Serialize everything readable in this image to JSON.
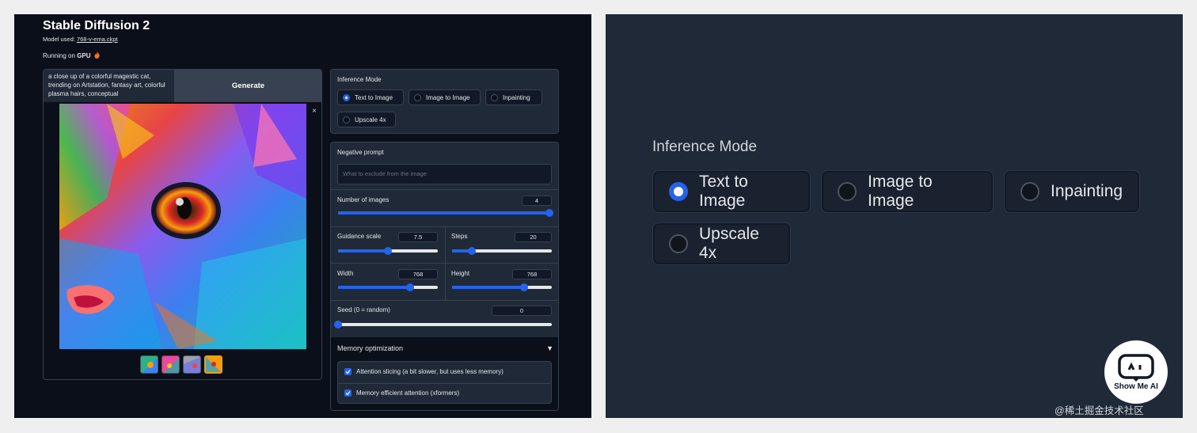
{
  "app": {
    "title": "Stable Diffusion 2",
    "model_label": "Model used:",
    "model_name": "768-v-ema.ckpt",
    "running_label": "Running on",
    "running_device": "GPU"
  },
  "prompt": {
    "value": "a close up of a colorful magestic cat, trending on Artstation, fantasy art, colorful plasma hairs, conceptual"
  },
  "generate_label": "Generate",
  "preview": {
    "close_glyph": "×"
  },
  "inference_mode": {
    "label": "Inference Mode",
    "options": [
      "Text to Image",
      "Image to Image",
      "Inpainting",
      "Upscale 4x"
    ],
    "selected": "Text to Image"
  },
  "negative_prompt": {
    "label": "Negative prompt",
    "placeholder": "What to exclude from the image"
  },
  "num_images": {
    "label": "Number of images",
    "value": "4",
    "fraction": 1.0
  },
  "guidance": {
    "label": "Guidance scale",
    "value": "7.5",
    "fraction": 0.5
  },
  "steps": {
    "label": "Steps",
    "value": "20",
    "fraction": 0.2
  },
  "width": {
    "label": "Width",
    "value": "768",
    "fraction": 0.72
  },
  "height": {
    "label": "Height",
    "value": "768",
    "fraction": 0.72
  },
  "seed": {
    "label": "Seed (0 = random)",
    "value": "0",
    "fraction": 0.0
  },
  "memory": {
    "label": "Memory optimization",
    "caret": "▼",
    "options": [
      {
        "label": "Attention slicing (a bit slower, but uses less memory)",
        "checked": true
      },
      {
        "label": "Memory efficient attention (xformers)",
        "checked": true
      }
    ]
  },
  "zoom": {
    "label": "Inference Mode",
    "options": [
      "Text to Image",
      "Image to Image",
      "Inpainting",
      "Upscale 4x"
    ]
  },
  "badge": {
    "text": "Show Me AI"
  },
  "watermark": "@稀土掘金技术社区",
  "colors": {
    "accent": "#2563eb",
    "background": "#0b0f19",
    "panel": "#1f2937",
    "border": "#374151"
  }
}
